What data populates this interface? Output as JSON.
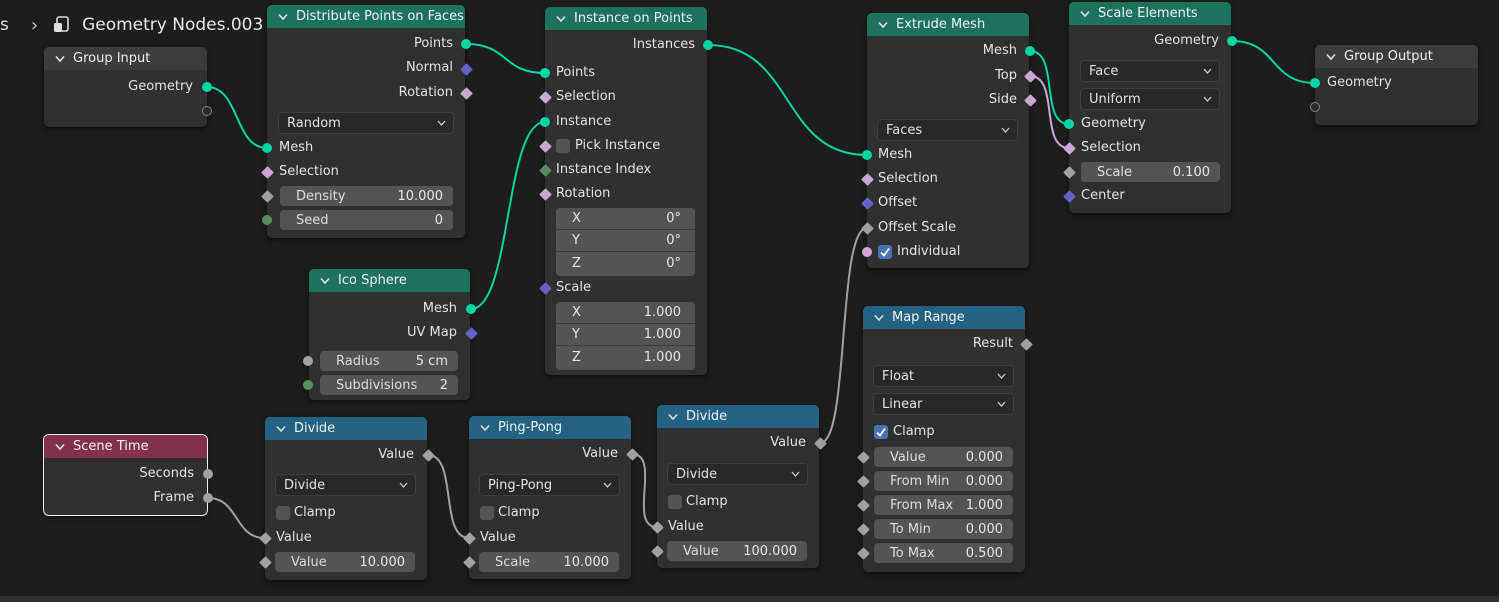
{
  "breadcrumb": {
    "previous": "s",
    "separator": "›",
    "tree_name": "Geometry Nodes.003"
  },
  "colors": {
    "geometry": "#00d6a3",
    "float": "#a1a1a1",
    "integer": "#598c5c",
    "vector": "#6363c7",
    "boolean": "#cca6d6",
    "header_geometry": "#1d725e",
    "header_converter": "#246283",
    "header_input": "#83314a",
    "wire": "#00d6a3"
  },
  "group_input": {
    "title": "Group Input",
    "out_geometry": "Geometry"
  },
  "distribute": {
    "title": "Distribute Points on Faces",
    "out_points": "Points",
    "out_normal": "Normal",
    "out_rotation": "Rotation",
    "mode": "Random",
    "in_mesh": "Mesh",
    "in_selection": "Selection",
    "density_label": "Density",
    "density_value": "10.000",
    "seed_label": "Seed",
    "seed_value": "0"
  },
  "ico": {
    "title": "Ico Sphere",
    "out_mesh": "Mesh",
    "out_uvmap": "UV Map",
    "radius_label": "Radius",
    "radius_value": "5 cm",
    "subdiv_label": "Subdivisions",
    "subdiv_value": "2"
  },
  "instance": {
    "title": "Instance on Points",
    "out_instances": "Instances",
    "in_points": "Points",
    "in_selection": "Selection",
    "in_instance": "Instance",
    "pick_instance": "Pick Instance",
    "in_instance_index": "Instance Index",
    "in_rotation": "Rotation",
    "rot_x_label": "X",
    "rot_x": "0°",
    "rot_y_label": "Y",
    "rot_y": "0°",
    "rot_z_label": "Z",
    "rot_z": "0°",
    "in_scale": "Scale",
    "sc_x_label": "X",
    "sc_x": "1.000",
    "sc_y_label": "Y",
    "sc_y": "1.000",
    "sc_z_label": "Z",
    "sc_z": "1.000"
  },
  "extrude": {
    "title": "Extrude Mesh",
    "out_mesh": "Mesh",
    "out_top": "Top",
    "out_side": "Side",
    "mode": "Faces",
    "in_mesh": "Mesh",
    "in_selection": "Selection",
    "in_offset": "Offset",
    "in_offset_scale": "Offset Scale",
    "individual": "Individual",
    "individual_checked": true
  },
  "scale": {
    "title": "Scale Elements",
    "out_geometry": "Geometry",
    "domain": "Face",
    "mode": "Uniform",
    "in_geometry": "Geometry",
    "in_selection": "Selection",
    "scale_label": "Scale",
    "scale_value": "0.100",
    "in_center": "Center"
  },
  "group_output": {
    "title": "Group Output",
    "in_geometry": "Geometry"
  },
  "map_range": {
    "title": "Map Range",
    "out_result": "Result",
    "data_type": "Float",
    "interp": "Linear",
    "clamp": "Clamp",
    "clamp_checked": true,
    "value_label": "Value",
    "value": "0.000",
    "from_min_label": "From Min",
    "from_min": "0.000",
    "from_max_label": "From Max",
    "from_max": "1.000",
    "to_min_label": "To Min",
    "to_min": "0.000",
    "to_max_label": "To Max",
    "to_max": "0.500"
  },
  "scene_time": {
    "title": "Scene Time",
    "out_seconds": "Seconds",
    "out_frame": "Frame"
  },
  "divide1": {
    "title": "Divide",
    "out_value": "Value",
    "op": "Divide",
    "clamp": "Clamp",
    "in_value": "Value",
    "value_label": "Value",
    "value": "10.000"
  },
  "pingpong": {
    "title": "Ping-Pong",
    "out_value": "Value",
    "op": "Ping-Pong",
    "clamp": "Clamp",
    "in_value": "Value",
    "scale_label": "Scale",
    "scale_value": "10.000"
  },
  "divide2": {
    "title": "Divide",
    "out_value": "Value",
    "op": "Divide",
    "clamp": "Clamp",
    "in_value": "Value",
    "value_label": "Value",
    "value": "100.000"
  }
}
